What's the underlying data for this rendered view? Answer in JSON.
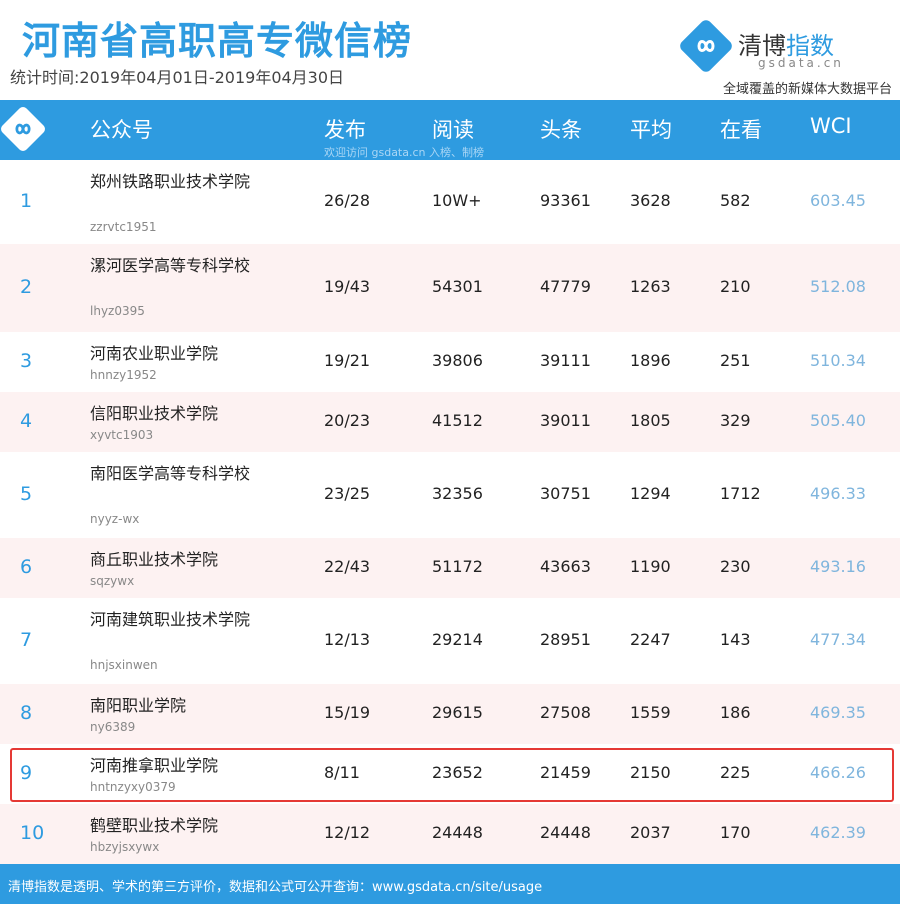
{
  "title": "河南省高职高专微信榜",
  "period": "统计时间:2019年04月01日-2019年04月30日",
  "brand": {
    "name_a": "清博",
    "name_b": "指数",
    "domain": "gsdata.cn",
    "tagline": "全域覆盖的新媒体大数据平台",
    "accent_color": "#2e9be0",
    "icon": "infinity-logo-icon"
  },
  "columns": {
    "account": "公众号",
    "published": "发布",
    "reads": "阅读",
    "headline": "头条",
    "average": "平均",
    "likes": "在看",
    "wci": "WCI"
  },
  "watermark": "欢迎访问 gsdata.cn 入榜、制榜",
  "rows": [
    {
      "rank": "1",
      "name": "郑州铁路职业技术学院",
      "account": "zzrvtc1951",
      "published": "26/28",
      "reads": "10W+",
      "headline": "93361",
      "average": "3628",
      "likes": "582",
      "wci": "603.45"
    },
    {
      "rank": "2",
      "name": "漯河医学高等专科学校",
      "account": "lhyz0395",
      "published": "19/43",
      "reads": "54301",
      "headline": "47779",
      "average": "1263",
      "likes": "210",
      "wci": "512.08"
    },
    {
      "rank": "3",
      "name": "河南农业职业学院",
      "account": "hnnzy1952",
      "published": "19/21",
      "reads": "39806",
      "headline": "39111",
      "average": "1896",
      "likes": "251",
      "wci": "510.34"
    },
    {
      "rank": "4",
      "name": "信阳职业技术学院",
      "account": "xyvtc1903",
      "published": "20/23",
      "reads": "41512",
      "headline": "39011",
      "average": "1805",
      "likes": "329",
      "wci": "505.40"
    },
    {
      "rank": "5",
      "name": "南阳医学高等专科学校",
      "account": "nyyz-wx",
      "published": "23/25",
      "reads": "32356",
      "headline": "30751",
      "average": "1294",
      "likes": "1712",
      "wci": "496.33"
    },
    {
      "rank": "6",
      "name": "商丘职业技术学院",
      "account": "sqzywx",
      "published": "22/43",
      "reads": "51172",
      "headline": "43663",
      "average": "1190",
      "likes": "230",
      "wci": "493.16"
    },
    {
      "rank": "7",
      "name": "河南建筑职业技术学院",
      "account": "hnjsxinwen",
      "published": "12/13",
      "reads": "29214",
      "headline": "28951",
      "average": "2247",
      "likes": "143",
      "wci": "477.34"
    },
    {
      "rank": "8",
      "name": "南阳职业学院",
      "account": "ny6389",
      "published": "15/19",
      "reads": "29615",
      "headline": "27508",
      "average": "1559",
      "likes": "186",
      "wci": "469.35"
    },
    {
      "rank": "9",
      "name": "河南推拿职业学院",
      "account": "hntnzyxy0379",
      "published": "8/11",
      "reads": "23652",
      "headline": "21459",
      "average": "2150",
      "likes": "225",
      "wci": "466.26"
    },
    {
      "rank": "10",
      "name": "鹤壁职业技术学院",
      "account": "hbzyjsxywx",
      "published": "12/12",
      "reads": "24448",
      "headline": "24448",
      "average": "2037",
      "likes": "170",
      "wci": "462.39"
    }
  ],
  "highlight_color": "#e53935",
  "footer": "清博指数是透明、学术的第三方评价，数据和公式可公开查询：www.gsdata.cn/site/usage"
}
